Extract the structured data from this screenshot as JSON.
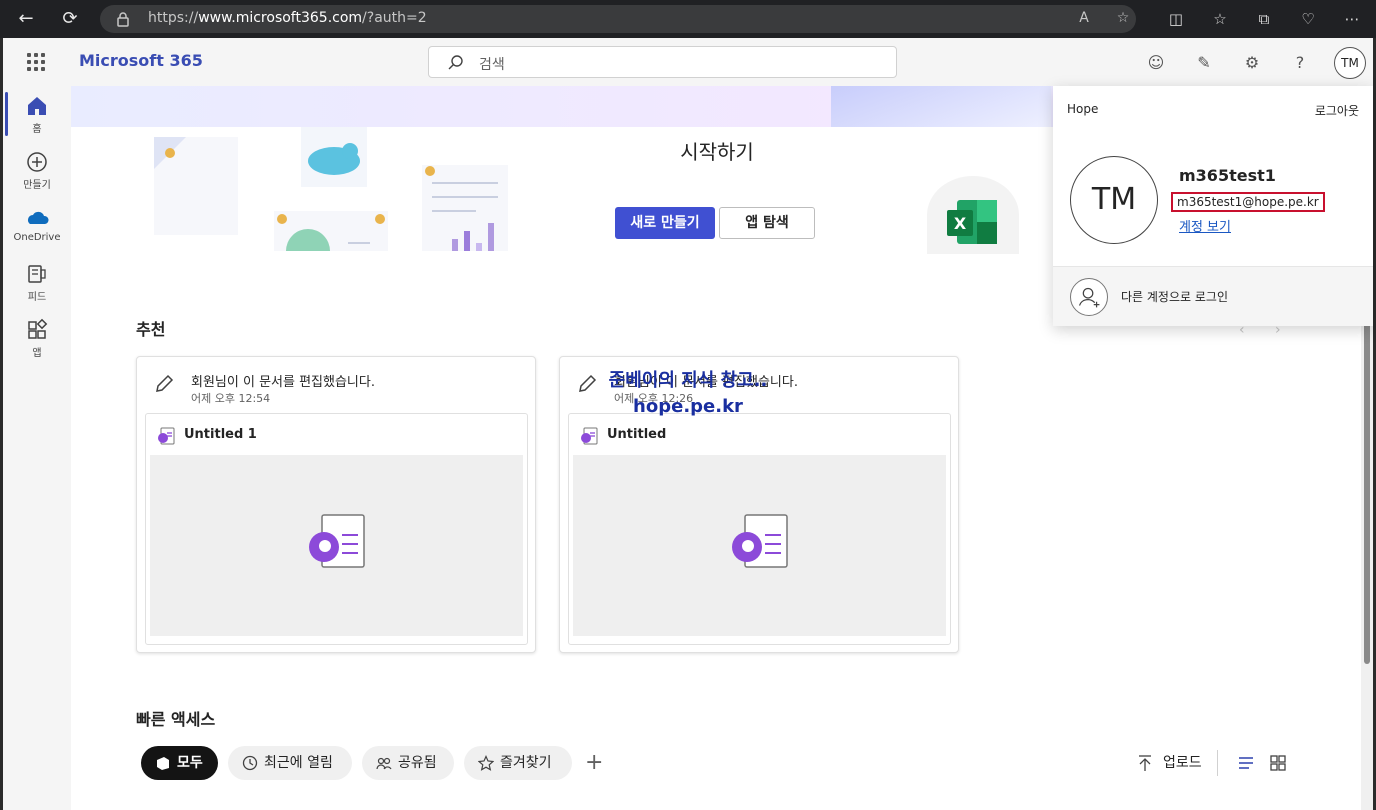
{
  "browser": {
    "url_prefix": "https://",
    "url_host": "www.microsoft365.com",
    "url_path": "/?auth=2"
  },
  "header": {
    "brand": "Microsoft 365",
    "search_placeholder": "검색",
    "avatar_initials": "TM"
  },
  "rail": {
    "items": [
      {
        "label": "홈",
        "icon": "home-icon"
      },
      {
        "label": "만들기",
        "icon": "create-icon"
      },
      {
        "label": "OneDrive",
        "icon": "onedrive-icon"
      },
      {
        "label": "피드",
        "icon": "feed-icon"
      },
      {
        "label": "앱",
        "icon": "apps-icon"
      }
    ]
  },
  "hero": {
    "title": "시작하기",
    "create_button": "새로 만들기",
    "explore_button": "앱 탐색"
  },
  "recommended": {
    "title": "추천",
    "cards": [
      {
        "activity": "회원님이 이 문서를 편집했습니다.",
        "time": "어제 오후 12:54",
        "doc_name": "Untitled 1"
      },
      {
        "activity": "회원님이 이 문서를 편집했습니다.",
        "time": "어제 오후 12:26",
        "doc_name": "Untitled"
      }
    ]
  },
  "watermark": {
    "line1": "준베이의 지식 창고..",
    "line2": "hope.pe.kr"
  },
  "quick_access": {
    "title": "빠른 액세스",
    "filters": [
      {
        "label": "모두",
        "active": true
      },
      {
        "label": "최근에 열림",
        "active": false
      },
      {
        "label": "공유됨",
        "active": false
      },
      {
        "label": "즐겨찾기",
        "active": false
      }
    ],
    "upload_label": "업로드"
  },
  "account": {
    "org": "Hope",
    "sign_out": "로그아웃",
    "initials": "TM",
    "name": "m365test1",
    "email": "m365test1@hope.pe.kr",
    "view_account": "계정 보기",
    "other_account": "다른 계정으로 로그인"
  },
  "colors": {
    "brand": "#3a4db3",
    "primary_button": "#4050d2",
    "email_highlight": "#c8102e",
    "link": "#1a57c2"
  }
}
